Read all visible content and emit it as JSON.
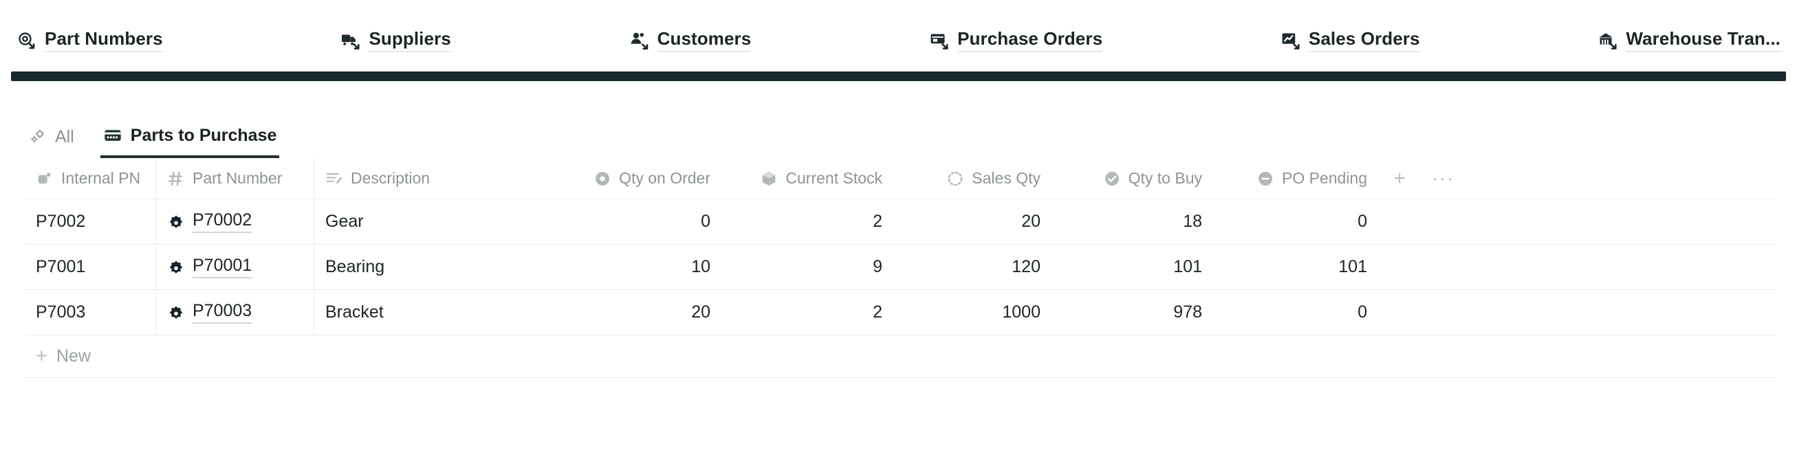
{
  "nav": {
    "items": [
      {
        "label": "Part Numbers",
        "icon": "part-numbers-icon"
      },
      {
        "label": "Suppliers",
        "icon": "truck-icon"
      },
      {
        "label": "Customers",
        "icon": "customers-icon"
      },
      {
        "label": "Purchase Orders",
        "icon": "purchase-orders-icon"
      },
      {
        "label": "Sales Orders",
        "icon": "sales-orders-icon"
      },
      {
        "label": "Warehouse Tran...",
        "icon": "warehouse-icon"
      }
    ],
    "accent_color": "#16292e"
  },
  "view_tabs": [
    {
      "label": "All",
      "icon": "gears-icon",
      "active": false
    },
    {
      "label": "Parts to Purchase",
      "icon": "card-icon",
      "active": true
    }
  ],
  "table": {
    "columns": [
      {
        "label": "Internal PN",
        "icon": "title-field-icon",
        "align": "left"
      },
      {
        "label": "Part Number",
        "icon": "number-field-icon",
        "align": "left"
      },
      {
        "label": "Description",
        "icon": "long-text-icon",
        "align": "left"
      },
      {
        "label": "Qty on Order",
        "icon": "rollup-icon",
        "align": "right"
      },
      {
        "label": "Current Stock",
        "icon": "cube-icon",
        "align": "right"
      },
      {
        "label": "Sales Qty",
        "icon": "dashed-circle-icon",
        "align": "right"
      },
      {
        "label": "Qty to Buy",
        "icon": "check-circle-icon",
        "align": "right"
      },
      {
        "label": "PO Pending",
        "icon": "minus-circle-icon",
        "align": "right"
      }
    ],
    "add_column_label": "+",
    "more_options_label": "···",
    "rows": [
      {
        "internal_pn": "P7002",
        "part_number": "P70002",
        "description": "Gear",
        "qty_on_order": "0",
        "current_stock": "2",
        "sales_qty": "20",
        "qty_to_buy": "18",
        "po_pending": "0"
      },
      {
        "internal_pn": "P7001",
        "part_number": "P70001",
        "description": "Bearing",
        "qty_on_order": "10",
        "current_stock": "9",
        "sales_qty": "120",
        "qty_to_buy": "101",
        "po_pending": "101"
      },
      {
        "internal_pn": "P7003",
        "part_number": "P70003",
        "description": "Bracket",
        "qty_on_order": "20",
        "current_stock": "2",
        "sales_qty": "1000",
        "qty_to_buy": "978",
        "po_pending": "0"
      }
    ],
    "new_row": {
      "label": "New",
      "icon": "plus-icon"
    }
  }
}
